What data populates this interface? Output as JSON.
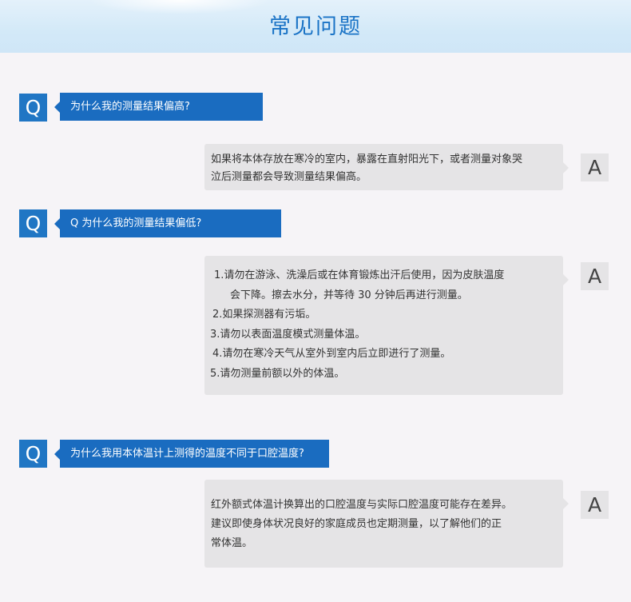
{
  "header": {
    "title": "常见问题"
  },
  "labels": {
    "q": "Q",
    "a": "A"
  },
  "faq": [
    {
      "question": "为什么我的测量结果偏高?",
      "answer": [
        "如果将本体存放在寒冷的室内，暴露在直射阳光下，或者测量对象哭",
        "泣后测量都会导致测量结果偏高。"
      ]
    },
    {
      "question": "Q  为什么我的测量结果偏低?",
      "answer": [
        "1.请勿在游泳、洗澡后或在体育锻炼出汗后使用，因为皮肤温度",
        "会下降。擦去水分，并等待 30 分钟后再进行测量。",
        "2.如果探测器有污垢。",
        "3.请勿以表面温度模式测量体温。",
        "4.请勿在寒冷天气从室外到室内后立即进行了测量。",
        "5.请勿测量前额以外的体温。"
      ]
    },
    {
      "question": "为什么我用本体温计上测得的温度不同于口腔温度?",
      "answer": [
        "红外额式体温计换算出的口腔温度与实际口腔温度可能存在差异。",
        "建议即使身体状况良好的家庭成员也定期测量，以了解他们的正",
        "常体温。"
      ]
    }
  ]
}
